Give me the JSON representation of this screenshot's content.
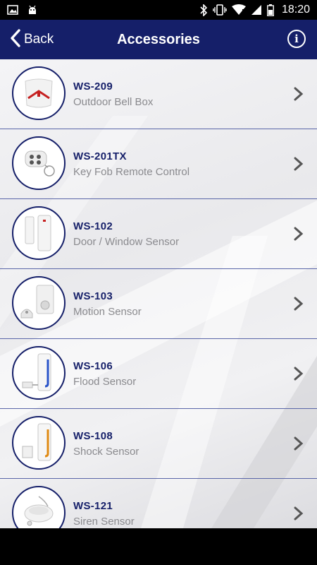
{
  "status_bar": {
    "time": "18:20",
    "icons": [
      "image-icon",
      "android-icon",
      "bluetooth-icon",
      "vibrate-icon",
      "wifi-icon",
      "signal-icon",
      "battery-icon"
    ]
  },
  "header": {
    "back_label": "Back",
    "title": "Accessories",
    "info_glyph": "i",
    "background": "#151f69"
  },
  "accessories": [
    {
      "code": "WS-209",
      "name": "Outdoor Bell Box",
      "icon": "bell-box-icon"
    },
    {
      "code": "WS-201TX",
      "name": "Key Fob Remote Control",
      "icon": "key-fob-icon"
    },
    {
      "code": "WS-102",
      "name": "Door / Window Sensor",
      "icon": "door-sensor-icon"
    },
    {
      "code": "WS-103",
      "name": "Motion Sensor",
      "icon": "motion-sensor-icon"
    },
    {
      "code": "WS-106",
      "name": "Flood Sensor",
      "icon": "flood-sensor-icon"
    },
    {
      "code": "WS-108",
      "name": "Shock Sensor",
      "icon": "shock-sensor-icon"
    },
    {
      "code": "WS-121",
      "name": "Siren Sensor",
      "icon": "siren-icon"
    }
  ]
}
